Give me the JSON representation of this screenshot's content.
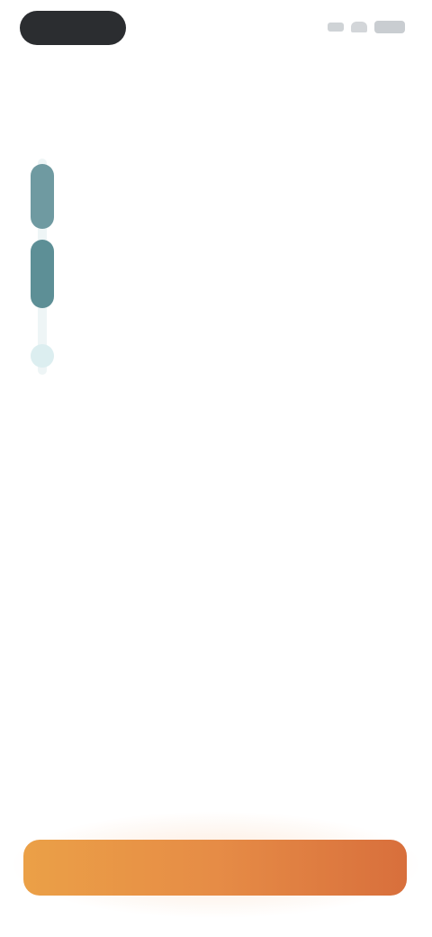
{
  "header": {
    "title": ""
  },
  "timeline": {
    "items": [
      {
        "label": "",
        "text": ""
      },
      {
        "label": "",
        "text": ""
      },
      {
        "label": "",
        "text": ""
      }
    ]
  },
  "cta": {
    "label": ""
  },
  "colors": {
    "accent_teal": "#5d8f96",
    "cta_start": "#eba047",
    "cta_end": "#d86f3c"
  }
}
